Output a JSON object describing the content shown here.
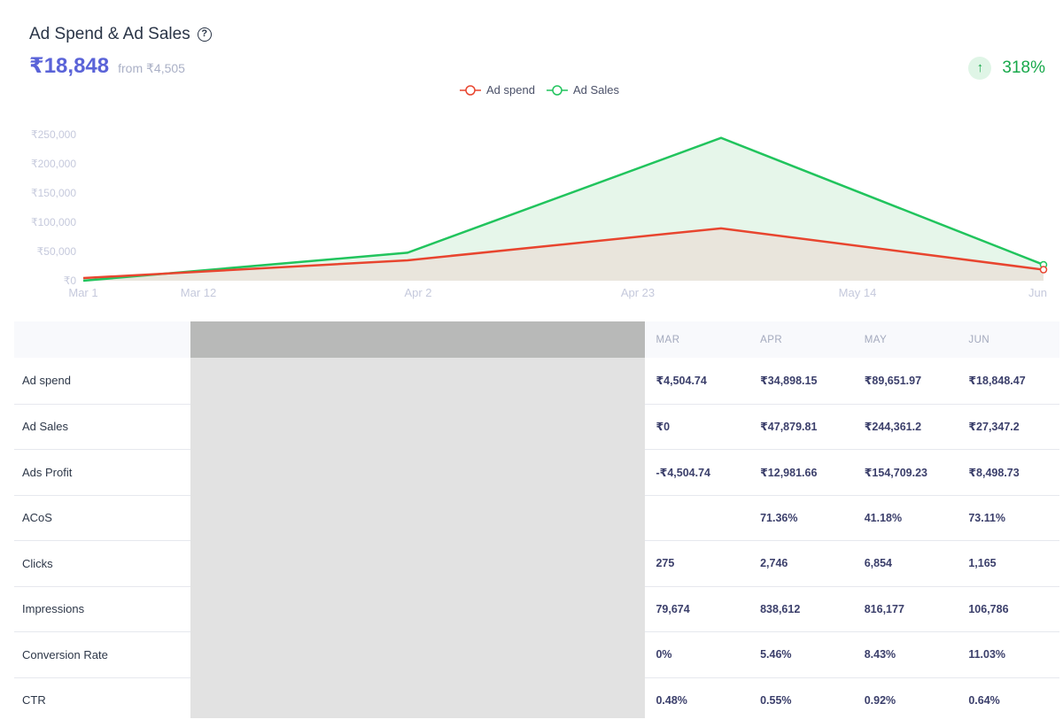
{
  "header": {
    "title": "Ad Spend & Ad Sales",
    "help_icon": "?",
    "value": "₹18,848",
    "from_text": "from ₹4,505",
    "change_arrow": "↑",
    "change": "318%"
  },
  "colors": {
    "ad_spend": "#e8452f",
    "ad_sales": "#21c45d",
    "accent": "#5a63d8",
    "positive": "#17a84a"
  },
  "chart_data": {
    "type": "area",
    "title": "Ad Spend & Ad Sales",
    "x_tick_labels": [
      "Mar 1",
      "Mar 12",
      "Apr 2",
      "Apr 23",
      "May 14",
      "Jun"
    ],
    "x_categories": [
      "Mar",
      "Apr",
      "May",
      "Jun"
    ],
    "y_tick_labels": [
      "₹250,000",
      "₹200,000",
      "₹150,000",
      "₹100,000",
      "₹50,000",
      "₹0"
    ],
    "ylim": [
      0,
      250000
    ],
    "legend": [
      "Ad spend",
      "Ad Sales"
    ],
    "legend_position": "top-center",
    "series": [
      {
        "name": "Ad spend",
        "values": [
          4504.74,
          34898.15,
          89651.97,
          18848.47
        ]
      },
      {
        "name": "Ad Sales",
        "values": [
          0,
          47879.81,
          244361.2,
          27347.2
        ]
      }
    ]
  },
  "table": {
    "months": [
      "MAR",
      "APR",
      "MAY",
      "JUN"
    ],
    "rows": [
      {
        "label": "Ad spend",
        "values": [
          "₹4,504.74",
          "₹34,898.15",
          "₹89,651.97",
          "₹18,848.47"
        ]
      },
      {
        "label": "Ad Sales",
        "values": [
          "₹0",
          "₹47,879.81",
          "₹244,361.2",
          "₹27,347.2"
        ]
      },
      {
        "label": "Ads Profit",
        "values": [
          "-₹4,504.74",
          "₹12,981.66",
          "₹154,709.23",
          "₹8,498.73"
        ]
      },
      {
        "label": "ACoS",
        "values": [
          "",
          "71.36%",
          "41.18%",
          "73.11%"
        ]
      },
      {
        "label": "Clicks",
        "values": [
          "275",
          "2,746",
          "6,854",
          "1,165"
        ]
      },
      {
        "label": "Impressions",
        "values": [
          "79,674",
          "838,612",
          "816,177",
          "106,786"
        ]
      },
      {
        "label": "Conversion Rate",
        "values": [
          "0%",
          "5.46%",
          "8.43%",
          "11.03%"
        ]
      },
      {
        "label": "CTR",
        "values": [
          "0.48%",
          "0.55%",
          "0.92%",
          "0.64%"
        ]
      }
    ]
  }
}
